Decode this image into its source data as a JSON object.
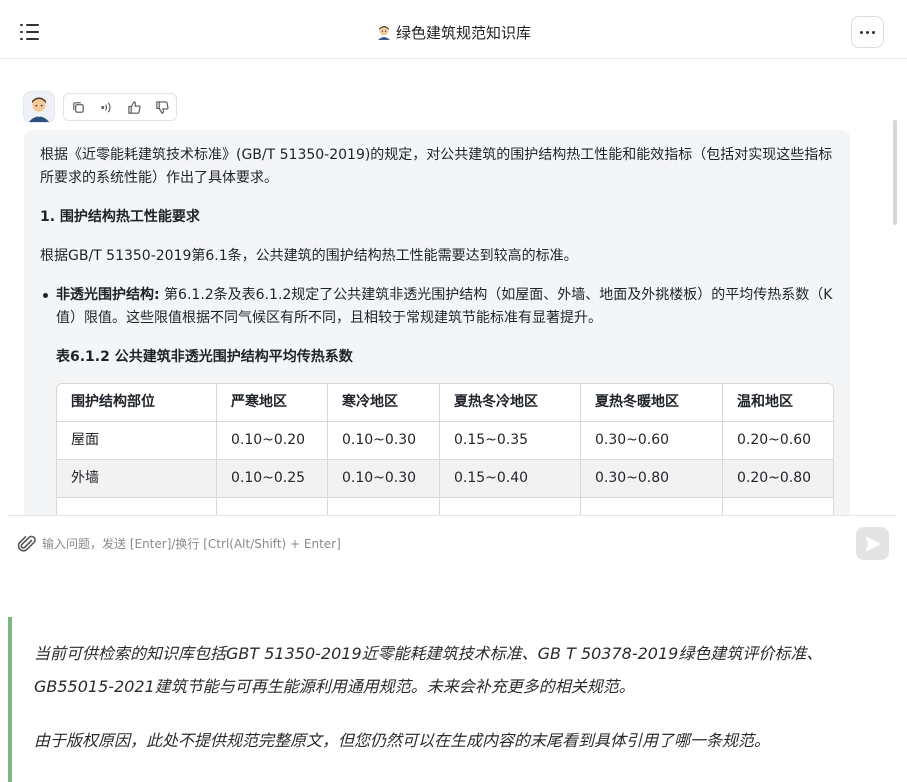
{
  "header": {
    "title": "绿色建筑规范知识库",
    "title_icon": "person-avatar-icon",
    "menu_icon": "list-menu-icon",
    "more_icon": "more-dots-icon"
  },
  "message": {
    "avatar_icon": "person-avatar-icon",
    "actions": [
      "copy-icon",
      "speaker-icon",
      "thumbs-up-icon",
      "thumbs-down-icon"
    ],
    "intro": "根据《近零能耗建筑技术标准》(GB/T 51350-2019)的规定，对公共建筑的围护结构热工性能和能效指标（包括对实现这些指标所要求的系统性能）作出了具体要求。",
    "section_heading": "1. 围护结构热工性能要求",
    "section_para": "根据GB/T 51350-2019第6.1条，公共建筑的围护结构热工性能需要达到较高的标准。",
    "bullet_label": "非透光围护结构:",
    "bullet_text": " 第6.1.2条及表6.1.2规定了公共建筑非透光围护结构（如屋面、外墙、地面及外挑楼板）的平均传热系数（K值）限值。这些限值根据不同气候区有所不同，且相较于常规建筑节能标准有显著提升。",
    "table_title": "表6.1.2 公共建筑非透光围护结构平均传热系数",
    "table": {
      "headers": [
        "围护结构部位",
        "严寒地区",
        "寒冷地区",
        "夏热冬冷地区",
        "夏热冬暖地区",
        "温和地区"
      ],
      "rows": [
        [
          "屋面",
          "0.10~0.20",
          "0.10~0.30",
          "0.15~0.35",
          "0.30~0.60",
          "0.20~0.60"
        ],
        [
          "外墙",
          "0.10~0.25",
          "0.10~0.30",
          "0.15~0.40",
          "0.30~0.80",
          "0.20~0.80"
        ],
        [
          "",
          "",
          "",
          "",
          "",
          ""
        ]
      ]
    }
  },
  "input": {
    "placeholder": "输入问题，发送 [Enter]/换行 [Ctrl(Alt/Shift) + Enter]",
    "value": "",
    "attach_icon": "paperclip-icon",
    "send_icon": "send-icon"
  },
  "notice": {
    "line1": "当前可供检索的知识库包括GBT 51350-2019近零能耗建筑技术标准、GB T 50378-2019绿色建筑评价标准、GB55015-2021建筑节能与可再生能源利用通用规范。未来会补充更多的相关规范。",
    "line2": "由于版权原因，此处不提供规范完整原文，但您仍然可以在生成内容的末尾看到具体引用了哪一条规范。"
  },
  "colors": {
    "notice_border": "#7bb77e",
    "bubble_bg": "#f4f5f7",
    "alt_row": "#f2f2f2"
  }
}
